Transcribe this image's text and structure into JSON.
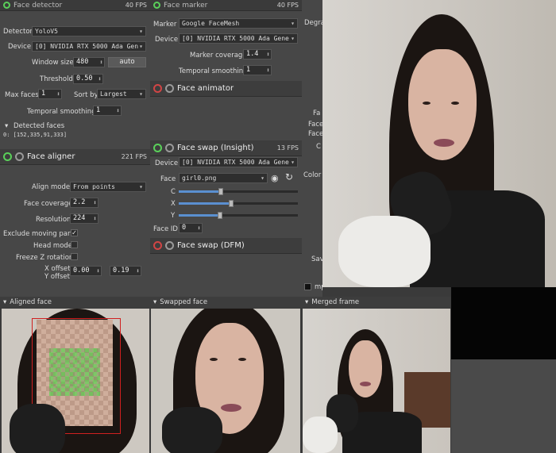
{
  "col1": {
    "top_label": "Face detector",
    "top_fps": "40 FPS",
    "detector_label": "Detector",
    "detector_value": "YoloV5",
    "device_label": "Device",
    "device_value": "[0] NVIDIA RTX 5000 Ada Gen",
    "window_size_label": "Window size",
    "window_size_value": "480",
    "auto_label": "auto",
    "threshold_label": "Threshold",
    "threshold_value": "0.50",
    "max_faces_label": "Max faces",
    "max_faces_value": "1",
    "sort_by_label": "Sort by",
    "sort_by_value": "Largest",
    "temporal_label": "Temporal smoothing",
    "temporal_value": "1",
    "detected_label": "Detected faces",
    "detected_value": "0: [152,335,91,333]",
    "aligner_title": "Face aligner",
    "aligner_fps": "221 FPS",
    "align_mode_label": "Align mode",
    "align_mode_value": "From points",
    "face_coverage_label": "Face coverage",
    "face_coverage_value": "2.2",
    "resolution_label": "Resolution",
    "resolution_value": "224",
    "exclude_label": "Exclude moving parts",
    "exclude_mark": "✓",
    "head_mode_label": "Head mode",
    "freeze_label": "Freeze Z rotation",
    "x_offset_label": "X offset",
    "y_offset_label": "Y offset",
    "x_offset_value": "0.00",
    "y_offset_value": "0.19"
  },
  "col2": {
    "top_label": "Face marker",
    "top_fps": "40 FPS",
    "marker_label": "Marker",
    "marker_value": "Google FaceMesh",
    "device_label": "Device",
    "device_value": "[0] NVIDIA RTX 5000 Ada Gene",
    "marker_coverage_label": "Marker coverage",
    "marker_coverage_value": "1.4",
    "temporal_label": "Temporal smoothing",
    "temporal_value": "1",
    "animator_title": "Face animator",
    "swap_title": "Face swap (Insight)",
    "swap_fps": "13 FPS",
    "swap_device_label": "Device",
    "swap_device_value": "[0] NVIDIA RTX 5000 Ada Gene",
    "face_label": "Face",
    "face_value": "girl0.png",
    "c_label": "C",
    "x_label": "X",
    "y_label": "Y",
    "face_id_label": "Face ID",
    "face_id_value": "0",
    "dfm_title": "Face swap (DFM)"
  },
  "col3": {
    "degrade_label": "Degra",
    "fa_label": "Fa",
    "face_label": "Face",
    "face2_label": "Face",
    "c_label": "C",
    "color_label": "Color",
    "sav_label": "Sav",
    "mpeg_label": "mpegts"
  },
  "bottom": {
    "aligned_label": "Aligned face",
    "swapped_label": "Swapped face",
    "merged_label": "Merged frame"
  }
}
